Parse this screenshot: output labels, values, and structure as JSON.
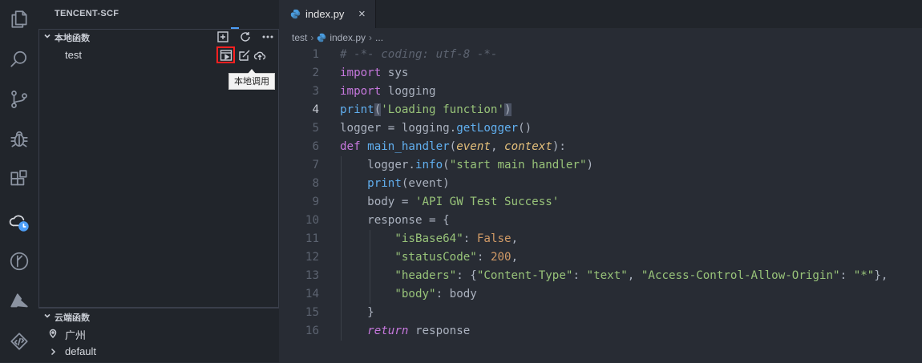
{
  "activity_bar": {
    "items": [
      {
        "icon": "files-icon"
      },
      {
        "icon": "search-icon"
      },
      {
        "icon": "source-control-icon"
      },
      {
        "icon": "debug-icon"
      },
      {
        "icon": "extensions-icon"
      },
      {
        "icon": "tencent-cloud-icon"
      },
      {
        "icon": "git-branch-circle-icon"
      },
      {
        "icon": "azure-icon"
      },
      {
        "icon": "remote-icon"
      }
    ]
  },
  "sidebar": {
    "title": "TENCENT-SCF",
    "local_section": {
      "label": "本地函数",
      "function_name": "test",
      "tooltip": "本地调用"
    },
    "cloud_section": {
      "label": "云端函数",
      "region": "广州",
      "namespace": "default"
    }
  },
  "editor": {
    "tab": {
      "filename": "index.py",
      "close": "×"
    },
    "breadcrumb": {
      "folder": "test",
      "file": "index.py",
      "more": "..."
    },
    "line_numbers": [
      "1",
      "2",
      "3",
      "4",
      "5",
      "6",
      "7",
      "8",
      "9",
      "10",
      "11",
      "12",
      "13",
      "14",
      "15",
      "16"
    ],
    "code": {
      "l1": "# -*- coding: utf-8 -*-",
      "import": "import",
      "sys": "sys",
      "logging": "logging",
      "print": "print",
      "lparen": "(",
      "rparen": ")",
      "loading": "'Loading function'",
      "logger_assign": "logger = logging.",
      "getLogger": "getLogger",
      "parens": "()",
      "def": "def",
      "main_handler": "main_handler",
      "event": "event",
      "comma_space": ", ",
      "context": "context",
      "paren_colon": "):",
      "logger_dot": "logger.",
      "info": "info",
      "start_msg": "\"start main handler\"",
      "print_event": "(event)",
      "body_assign": "body = ",
      "body_val": "'API GW Test Success'",
      "response_assign": "response = {",
      "isBase64_key": "\"isBase64\"",
      "colon_space": ": ",
      "false": "False",
      "comma": ",",
      "statusCode_key": "\"statusCode\"",
      "status_val": "200",
      "headers_key": "\"headers\"",
      "open_brace": ": {",
      "ct_key": "\"Content-Type\"",
      "ct_val": "\"text\"",
      "acao_key": "\"Access-Control-Allow-Origin\"",
      "acao_val": "\"*\"",
      "close_brace_comma": "},",
      "body_key": "\"body\"",
      "body_ref": ": body",
      "close_brace": "}",
      "return": "return",
      "return_val": " response"
    }
  }
}
